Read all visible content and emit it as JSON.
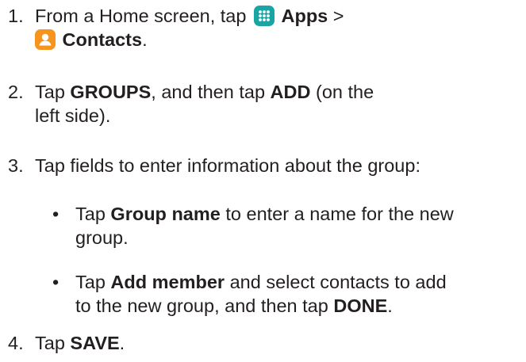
{
  "steps": [
    {
      "number": "1.",
      "segments": {
        "t1": "From a Home screen, tap",
        "b1": "Apps",
        "t2": ">",
        "b2": "Contacts",
        "t3": "."
      },
      "icons": [
        "apps-icon",
        "contacts-icon"
      ]
    },
    {
      "number": "2.",
      "segments": {
        "t1": "Tap",
        "b1": "GROUPS",
        "t2": ", and then tap",
        "b2": "ADD",
        "t3": "(on the",
        "t4": "left side)."
      }
    },
    {
      "number": "3.",
      "segments": {
        "t1": "Tap fields to enter information about the group:"
      },
      "bullets": [
        {
          "dot": "•",
          "t1": "Tap",
          "b1": "Group name",
          "t2": "to enter a name for the new",
          "t3": "group."
        },
        {
          "dot": "•",
          "t1": "Tap",
          "b1": "Add member",
          "t2": "and select contacts to add",
          "t3": "to the new group, and then tap",
          "b2": "DONE",
          "t4": "."
        }
      ]
    },
    {
      "number": "4.",
      "segments": {
        "t1": "Tap",
        "b1": "SAVE",
        "t2": "."
      }
    }
  ],
  "colors": {
    "text": "#231f20",
    "apps_icon_bg": "#1aa5a5",
    "contacts_icon_bg": "#f7941d"
  }
}
